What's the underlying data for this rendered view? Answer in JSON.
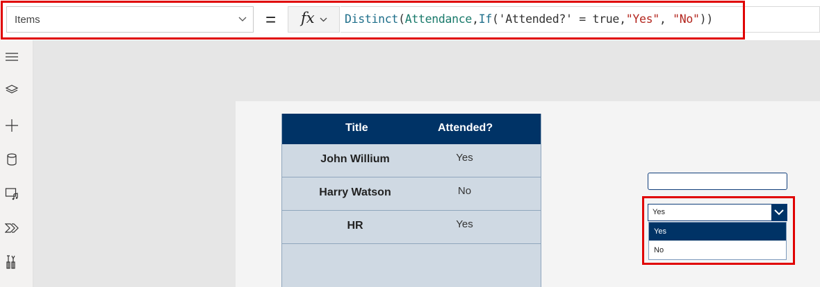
{
  "formula_bar": {
    "property": "Items",
    "equals": "=",
    "fx_label": "fx",
    "formula_parts": [
      {
        "t": "Distinct",
        "c": "fn"
      },
      {
        "t": "(",
        "c": "punc"
      },
      {
        "t": "Attendance",
        "c": "id"
      },
      {
        "t": ",",
        "c": "punc"
      },
      {
        "t": "If",
        "c": "fn"
      },
      {
        "t": "(",
        "c": "punc"
      },
      {
        "t": "'Attended?'",
        "c": "lit"
      },
      {
        "t": " = ",
        "c": "punc"
      },
      {
        "t": "true",
        "c": "lit"
      },
      {
        "t": ",",
        "c": "punc"
      },
      {
        "t": "\"Yes\"",
        "c": "str"
      },
      {
        "t": ", ",
        "c": "punc"
      },
      {
        "t": "\"No\"",
        "c": "str"
      },
      {
        "t": "))",
        "c": "punc"
      }
    ]
  },
  "rail": {
    "icons": [
      "tree-view-icon",
      "layers-icon",
      "insert-plus-icon",
      "data-cylinder-icon",
      "media-icon",
      "power-automate-icon",
      "advanced-tools-icon"
    ]
  },
  "table": {
    "headers": [
      "Title",
      "Attended?"
    ],
    "rows": [
      {
        "title": "John Willium",
        "attended": "Yes"
      },
      {
        "title": "Harry Watson",
        "attended": "No"
      },
      {
        "title": "HR",
        "attended": "Yes"
      }
    ]
  },
  "text_input": {
    "value": ""
  },
  "dropdown": {
    "selected": "Yes",
    "options": [
      "Yes",
      "No"
    ]
  },
  "colors": {
    "header_bg": "#003366",
    "table_bg": "#cfd9e3",
    "highlight": "#e00000"
  }
}
